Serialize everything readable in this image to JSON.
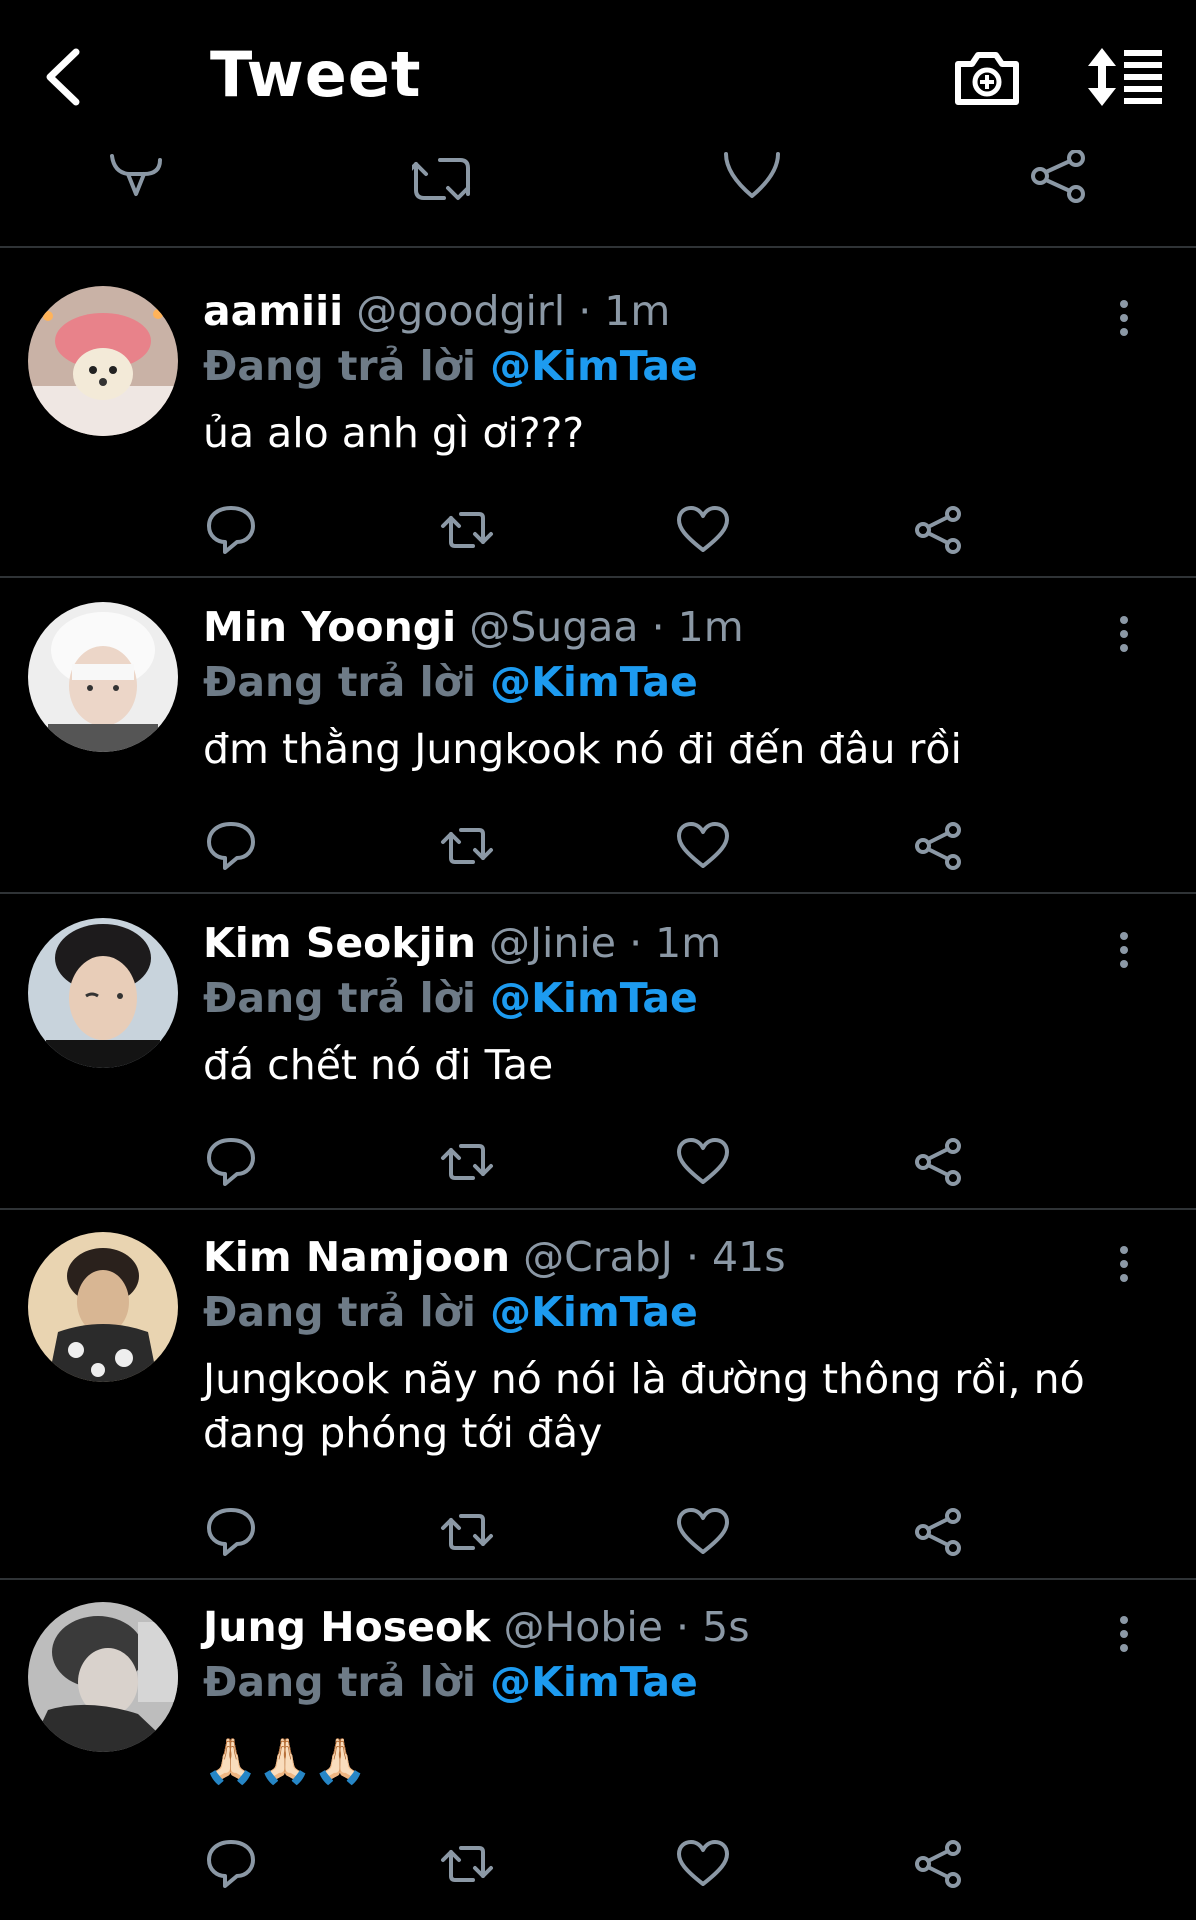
{
  "header": {
    "title": "Tweet"
  },
  "replying_prefix": "Đang trả lời",
  "replies": [
    {
      "name": "aamiii",
      "handle": "@goodgirl",
      "time": "1m",
      "mention": "@KimTae",
      "text": "ủa alo anh gì ơi???"
    },
    {
      "name": "Min Yoongi",
      "handle": "@Sugaa",
      "time": "1m",
      "mention": "@KimTae",
      "text": "đm thằng Jungkook nó đi đến đâu rồi"
    },
    {
      "name": "Kim Seokjin",
      "handle": "@Jinie",
      "time": "1m",
      "mention": "@KimTae",
      "text": "đá chết nó đi Tae"
    },
    {
      "name": "Kim Namjoon",
      "handle": "@CrabJ",
      "time": "41s",
      "mention": "@KimTae",
      "text": "Jungkook nãy nó nói là đường thông rồi, nó đang phóng tới đây"
    },
    {
      "name": "Jung Hoseok",
      "handle": "@Hobie",
      "time": "5s",
      "mention": "@KimTae",
      "text": "🙏🏻🙏🏻🙏🏻"
    }
  ],
  "icons": [
    "back-icon",
    "camera-icon",
    "sort-icon",
    "reply-icon",
    "retweet-icon",
    "like-icon",
    "share-icon",
    "more-icon"
  ],
  "colors": {
    "background": "#000000",
    "accent": "#1d9bf0",
    "muted": "#8b98a5",
    "divider": "#2f3336"
  }
}
